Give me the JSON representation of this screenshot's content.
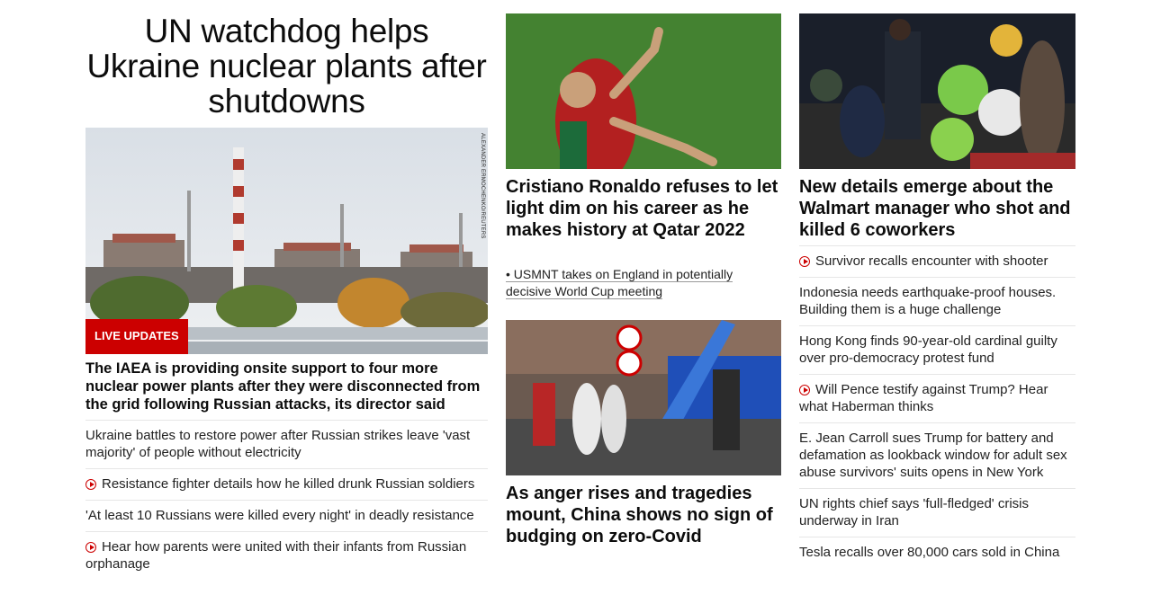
{
  "main_story": {
    "headline": "UN watchdog helps Ukraine nuclear plants after shutdowns",
    "live_badge": "LIVE UPDATES",
    "photo_credit": "ALEXANDER ERMOCHENKO/REUTERS",
    "lead": "The IAEA is providing onsite support to four more nuclear power plants after they were disconnected from the grid following Russian attacks, its director said",
    "related": [
      {
        "text": "Ukraine battles to restore power after Russian strikes leave 'vast majority' of people without electricity",
        "video": false
      },
      {
        "text": "Resistance fighter details how he killed drunk Russian soldiers",
        "video": true
      },
      {
        "text": "'At least 10 Russians were killed every night' in deadly resistance",
        "video": false
      },
      {
        "text": "Hear how parents were united with their infants from Russian orphanage",
        "video": true
      }
    ]
  },
  "middle": {
    "story1": {
      "title": "Cristiano Ronaldo refuses to let light dim on his career as he makes history at Qatar 2022",
      "sub": "• USMNT takes on England in potentially decisive World Cup meeting"
    },
    "story2": {
      "title": "As anger rises and tragedies mount, China shows no sign of budging on zero-Covid"
    }
  },
  "right": {
    "title": "New details emerge about the Walmart manager who shot and killed 6 coworkers",
    "items": [
      {
        "text": "Survivor recalls encounter with shooter",
        "video": true
      },
      {
        "text": "Indonesia needs earthquake-proof houses. Building them is a huge challenge",
        "video": false
      },
      {
        "text": "Hong Kong finds 90-year-old cardinal guilty over pro-democracy protest fund",
        "video": false
      },
      {
        "text": "Will Pence testify against Trump? Hear what Haberman thinks",
        "video": true
      },
      {
        "text": "E. Jean Carroll sues Trump for battery and defamation as lookback window for adult sex abuse survivors' suits opens in New York",
        "video": false
      },
      {
        "text": "UN rights chief says 'full-fledged' crisis underway in Iran",
        "video": false
      },
      {
        "text": "Tesla recalls over 80,000 cars sold in China",
        "video": false
      }
    ]
  },
  "colors": {
    "accent": "#cc0000",
    "divider": "#e6e6e6"
  },
  "icons": {
    "video": "play-circle-icon"
  }
}
